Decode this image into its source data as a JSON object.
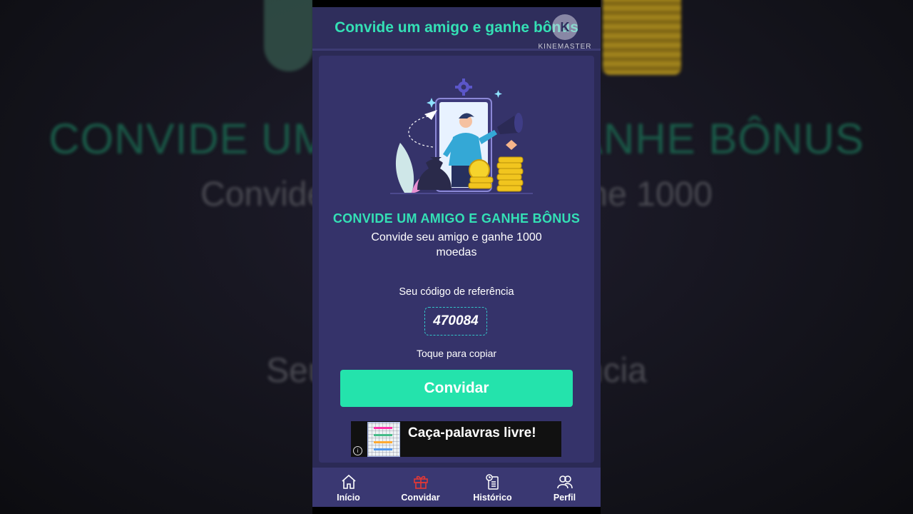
{
  "backdrop": {
    "title": "CONVIDE UM AMIGO E GANHE BÔNUS",
    "subtitle": "Convide seu amigo e ganhe 1000",
    "referral": "Seu código de referência"
  },
  "header": {
    "title": "Convide um amigo e ganhe bônus"
  },
  "watermark": {
    "text": "KINEMASTER"
  },
  "invite": {
    "title": "CONVIDE UM AMIGO E GANHE BÔNUS",
    "subtitle": "Convide seu amigo e ganhe 1000 moedas",
    "referral_label": "Seu código de referência",
    "referral_code": "470084",
    "copy_hint": "Toque para copiar",
    "button_label": "Convidar"
  },
  "ad": {
    "text": "Caça-palavras livre!",
    "info_icon": "info-icon"
  },
  "nav": {
    "items": [
      {
        "label": "Início",
        "icon": "home-icon"
      },
      {
        "label": "Convidar",
        "icon": "gift-icon"
      },
      {
        "label": "Histórico",
        "icon": "history-icon"
      },
      {
        "label": "Perfil",
        "icon": "profile-icon"
      }
    ]
  },
  "colors": {
    "accent": "#34e0b5",
    "button": "#24e3ac",
    "background": "#2b2a55",
    "card": "#35336a",
    "nav_active": "#e53935"
  }
}
